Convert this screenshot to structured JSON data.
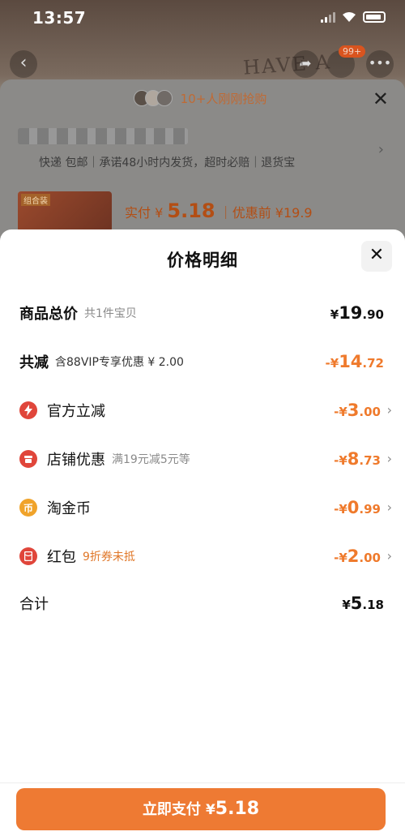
{
  "status_bar": {
    "time": "13:57"
  },
  "background": {
    "cart_badge": "99+",
    "bg_text": "HAVE A",
    "grab_text": "10+人刚刚抢购",
    "service_line": "快递 包邮｜承诺48小时内发货，超时必赔｜退货宝",
    "thumb_tag": "组合装",
    "price_label": "实付 ¥",
    "price_value": "5.18",
    "before_label": "｜优惠前 ¥19.9"
  },
  "sheet": {
    "title": "价格明细",
    "rows": [
      {
        "label": "商品总价",
        "sub": "共1件宝贝",
        "currency": "¥",
        "int": "19",
        "dec": ".90"
      },
      {
        "label": "共减",
        "sub": "含88VIP专享优惠 ¥ 2.00",
        "currency": "-¥",
        "int": "14",
        "dec": ".72"
      },
      {
        "label": "官方立减",
        "sub": "",
        "currency": "-¥",
        "int": "3",
        "dec": ".00",
        "icon": "lightning-icon"
      },
      {
        "label": "店铺优惠",
        "sub": "满19元减5元等",
        "currency": "-¥",
        "int": "8",
        "dec": ".73",
        "icon": "shop-icon"
      },
      {
        "label": "淘金币",
        "sub": "",
        "currency": "-¥",
        "int": "0",
        "dec": ".99",
        "icon": "coin-icon"
      },
      {
        "label": "红包",
        "sub": "9折券未抵",
        "currency": "-¥",
        "int": "2",
        "dec": ".00",
        "icon": "red-packet-icon"
      },
      {
        "label": "合计",
        "sub": "",
        "currency": "¥",
        "int": "5",
        "dec": ".18"
      }
    ]
  },
  "pay_button": {
    "label": "立即支付",
    "currency": "¥",
    "amount": "5.18"
  },
  "colors": {
    "accent": "#ee7a33",
    "orange_text": "#ef7a2c",
    "icon_red": "#e0463b",
    "icon_gold": "#f0a32a"
  }
}
